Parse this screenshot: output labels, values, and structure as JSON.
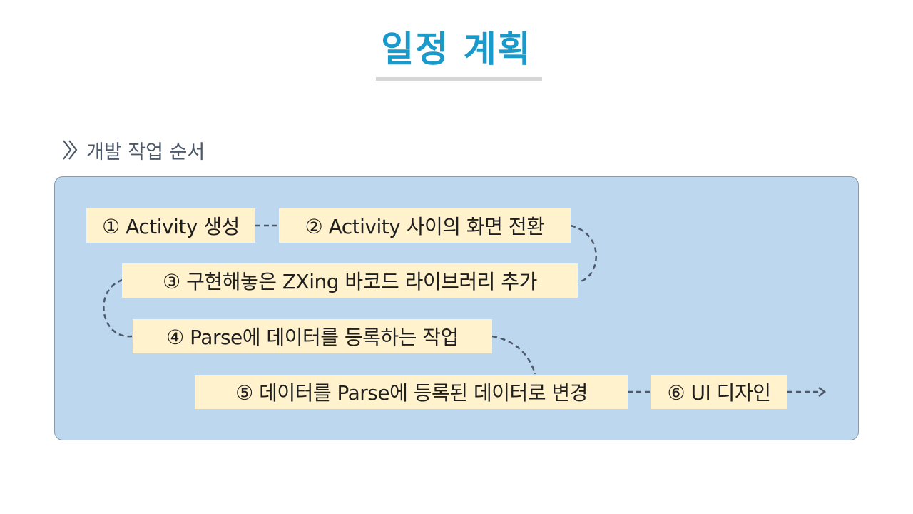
{
  "title": "일정 계획",
  "section_heading": "개발 작업 순서",
  "colors": {
    "title": "#1a9acb",
    "panel_background": "#bdd7ee",
    "step_background": "#fff2cc",
    "connector": "#4d5868"
  },
  "icons": {
    "section_marker": "double-chevron-right-icon",
    "end_arrow": "arrow-right-icon"
  },
  "steps": [
    {
      "label": "① Activity 생성"
    },
    {
      "label": "② Activity 사이의 화면 전환"
    },
    {
      "label": "③ 구현해놓은 ZXing 바코드 라이브러리 추가"
    },
    {
      "label": "④ Parse에 데이터를 등록하는 작업"
    },
    {
      "label": "⑤ 데이터를 Parse에 등록된 데이터로 변경"
    },
    {
      "label": "⑥ UI 디자인"
    }
  ]
}
